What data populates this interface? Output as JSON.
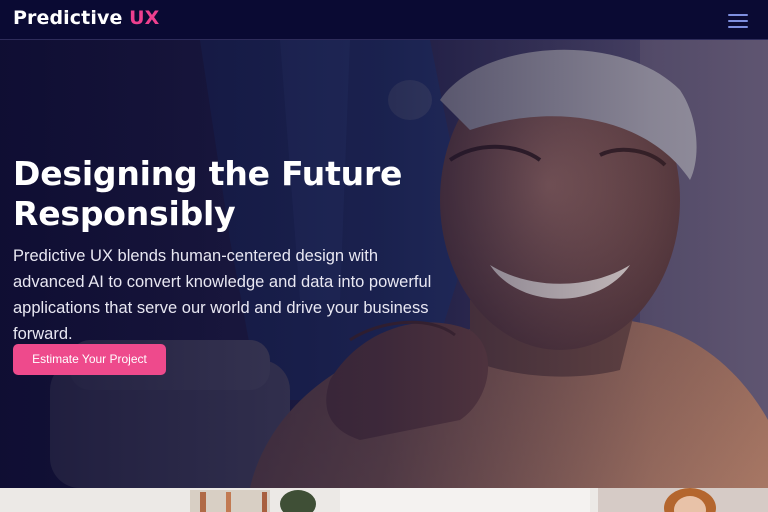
{
  "header": {
    "logo_main": "Predictive",
    "logo_accent": "UX",
    "menu_icon": "hamburger-menu-icon"
  },
  "hero": {
    "title": "Designing the Future Responsibly",
    "description": "Predictive UX blends human-centered design with advanced AI to convert knowledge and data into powerful applications that serve our world and drive your business forward.",
    "cta_label": "Estimate Your Project",
    "image_subject": "smiling senior man with a caregiver's hand on his shoulder"
  },
  "colors": {
    "background": "#0b0a2e",
    "accent": "#ee4a8c",
    "menu_icon": "#7e8fe0"
  }
}
